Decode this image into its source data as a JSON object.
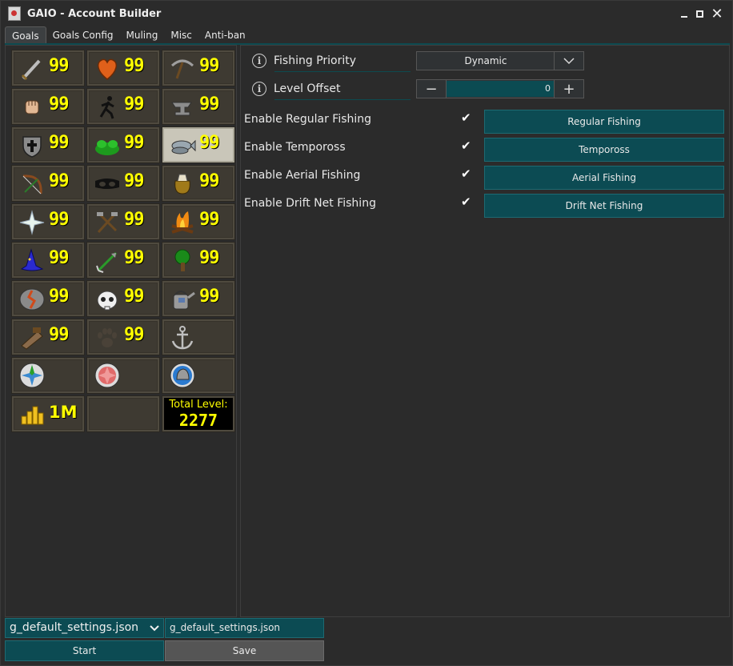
{
  "window": {
    "title": "GAIO - Account Builder"
  },
  "tabs": [
    "Goals",
    "Goals Config",
    "Muling",
    "Misc",
    "Anti-ban"
  ],
  "skills": [
    {
      "icon": "attack-sword-icon",
      "level": "99"
    },
    {
      "icon": "hitpoints-heart-icon",
      "level": "99"
    },
    {
      "icon": "mining-pickaxe-icon",
      "level": "99"
    },
    {
      "icon": "strength-fist-icon",
      "level": "99"
    },
    {
      "icon": "agility-runner-icon",
      "level": "99"
    },
    {
      "icon": "smithing-anvil-icon",
      "level": "99"
    },
    {
      "icon": "defence-shield-icon",
      "level": "99"
    },
    {
      "icon": "herblore-herb-icon",
      "level": "99"
    },
    {
      "icon": "fishing-fish-icon",
      "level": "99"
    },
    {
      "icon": "ranged-bow-icon",
      "level": "99"
    },
    {
      "icon": "thieving-mask-icon",
      "level": "99"
    },
    {
      "icon": "cooking-pot-icon",
      "level": "99"
    },
    {
      "icon": "prayer-star-icon",
      "level": "99"
    },
    {
      "icon": "crafting-tools-icon",
      "level": "99"
    },
    {
      "icon": "firemaking-fire-icon",
      "level": "99"
    },
    {
      "icon": "magic-hat-icon",
      "level": "99"
    },
    {
      "icon": "fletching-arrow-icon",
      "level": "99"
    },
    {
      "icon": "woodcutting-tree-icon",
      "level": "99"
    },
    {
      "icon": "runecraft-rune-icon",
      "level": "99"
    },
    {
      "icon": "slayer-skull-icon",
      "level": "99"
    },
    {
      "icon": "farming-watering-can-icon",
      "level": "99"
    },
    {
      "icon": "construction-saw-icon",
      "level": "99"
    },
    {
      "icon": "hunter-paw-icon",
      "level": "99"
    },
    {
      "icon": "sailing-anchor-icon",
      "level": ""
    }
  ],
  "orbs": [
    "quest-orb-icon",
    "combat-orb-icon",
    "helm-orb-icon"
  ],
  "gold": {
    "icon": "coins-icon",
    "amount": "1M"
  },
  "total": {
    "label": "Total Level:",
    "value": "2277"
  },
  "settings": {
    "priority": {
      "label": "Fishing Priority",
      "value": "Dynamic"
    },
    "offset": {
      "label": "Level Offset",
      "value": "0"
    },
    "options": [
      {
        "label": "Enable Regular Fishing",
        "checked": true,
        "button": "Regular Fishing"
      },
      {
        "label": "Enable Tempoross",
        "checked": true,
        "button": "Tempoross"
      },
      {
        "label": "Enable Aerial Fishing",
        "checked": true,
        "button": "Aerial Fishing"
      },
      {
        "label": "Enable Drift Net Fishing",
        "checked": true,
        "button": "Drift Net Fishing"
      }
    ]
  },
  "footer": {
    "profile": "g_default_settings.json",
    "filename": "g_default_settings.json",
    "start": "Start",
    "save": "Save"
  },
  "colors": {
    "accent": "#0c4b53",
    "level_text": "#ffff00",
    "background": "#2b2b2b"
  }
}
